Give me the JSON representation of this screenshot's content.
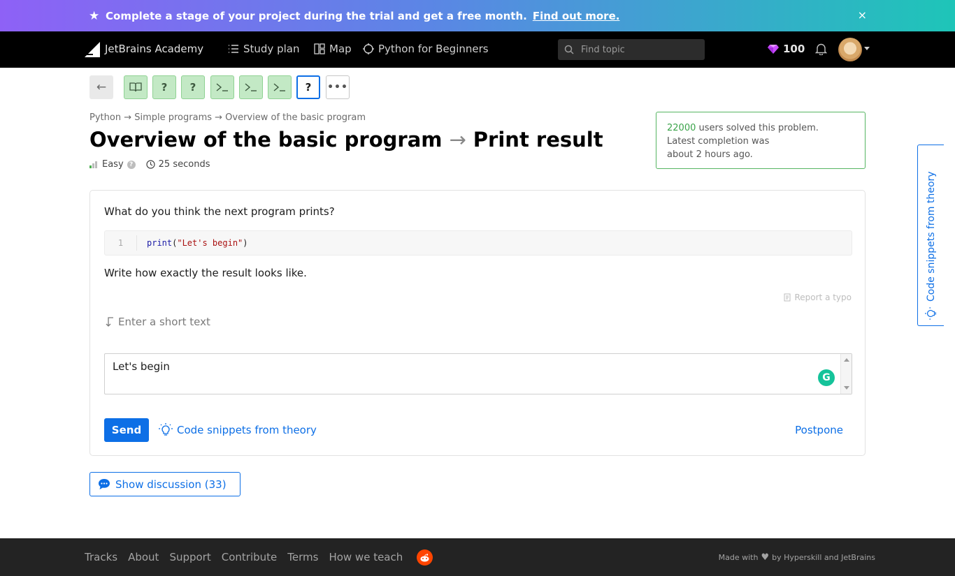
{
  "promo": {
    "text": "Complete a stage of your project during the trial and get a free month.",
    "link": "Find out more.",
    "close": "×"
  },
  "nav": {
    "brand": "JetBrains Academy",
    "study_plan": "Study plan",
    "map": "Map",
    "track": "Python for Beginners",
    "search_placeholder": "Find topic",
    "gems": "100"
  },
  "steps": [
    {
      "icon": "book-icon",
      "state": "done"
    },
    {
      "icon": "?",
      "state": "done"
    },
    {
      "icon": "?",
      "state": "done"
    },
    {
      "icon": "terminal-icon",
      "state": "done"
    },
    {
      "icon": "terminal-icon",
      "state": "done"
    },
    {
      "icon": "terminal-icon",
      "state": "done"
    },
    {
      "icon": "?",
      "state": "current"
    },
    {
      "icon": "•••",
      "state": "more"
    }
  ],
  "step_labels": {
    "q": "?",
    "more": "•••",
    "back": "←"
  },
  "breadcrumb": "Python → Simple programs → Overview of the basic program",
  "title": {
    "topic": "Overview of the basic program",
    "arrow": "→",
    "task": "Print result"
  },
  "meta": {
    "difficulty": "Easy",
    "help": "?",
    "duration": "25 seconds"
  },
  "stats": {
    "count": "22000",
    "line1_rest": " users solved this problem.",
    "line2": "Latest completion was",
    "line3": "about 2 hours ago."
  },
  "task": {
    "question": "What do you think the next program prints?",
    "code_line_number": "1",
    "code_fn": "print",
    "code_open": "(",
    "code_str": "\"Let's begin\"",
    "code_close": ")",
    "instruction": "Write how exactly the result looks like.",
    "report_typo": "Report a typo",
    "hint": "Enter a short text",
    "answer_value": "Let's begin",
    "grammarly": "G",
    "send": "Send",
    "snippets": "Code snippets from theory",
    "postpone": "Postpone"
  },
  "discussion": "Show discussion (33)",
  "side_tab": "Code snippets from theory",
  "footer": {
    "links": [
      "Tracks",
      "About",
      "Support",
      "Contribute",
      "Terms",
      "How we teach"
    ],
    "made_prefix": "Made with",
    "made_suffix": "by Hyperskill and JetBrains"
  },
  "colors": {
    "accent": "#0d6fe6",
    "success": "#3aa349",
    "nav_bg": "#000000",
    "footer_bg": "#232323"
  }
}
